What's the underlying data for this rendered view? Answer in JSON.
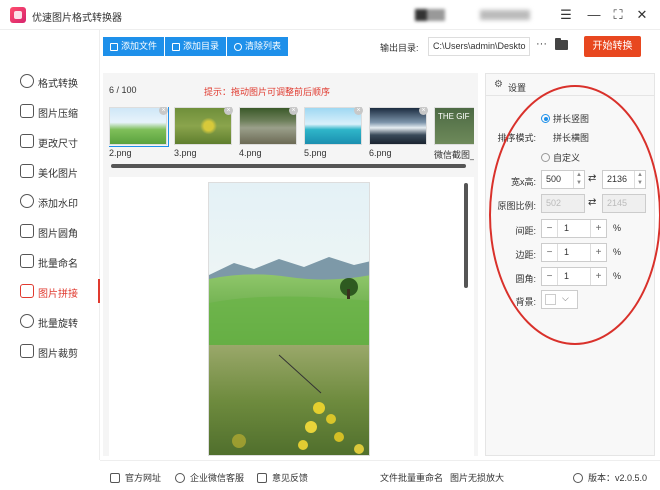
{
  "window": {
    "title": "优速图片格式转换器",
    "controls": [
      "menu",
      "minimize",
      "maximize",
      "close"
    ]
  },
  "sidebar": {
    "items": [
      {
        "label": "格式转换",
        "icon": "convert-icon",
        "active": false
      },
      {
        "label": "图片压缩",
        "icon": "compress-icon",
        "active": false
      },
      {
        "label": "更改尺寸",
        "icon": "resize-icon",
        "active": false
      },
      {
        "label": "美化图片",
        "icon": "beautify-icon",
        "active": false
      },
      {
        "label": "添加水印",
        "icon": "watermark-icon",
        "active": false
      },
      {
        "label": "图片圆角",
        "icon": "rounded-corner-icon",
        "active": false
      },
      {
        "label": "批量命名",
        "icon": "rename-icon",
        "active": false
      },
      {
        "label": "图片拼接",
        "icon": "stitch-icon",
        "active": true
      },
      {
        "label": "批量旋转",
        "icon": "rotate-icon",
        "active": false
      },
      {
        "label": "图片裁剪",
        "icon": "crop-icon",
        "active": false
      }
    ]
  },
  "toolbar": {
    "add_file": "添加文件",
    "add_folder": "添加目录",
    "clear_list": "清除列表",
    "output_label": "输出目录:",
    "output_path": "C:\\Users\\admin\\Deskto",
    "more": "···",
    "start": "开始转换"
  },
  "main": {
    "count": "6 / 100",
    "tip": "提示：拖动图片可调整前后顺序",
    "thumbnails": [
      {
        "name": "2.png"
      },
      {
        "name": "3.png"
      },
      {
        "name": "4.png"
      },
      {
        "name": "5.png"
      },
      {
        "name": "6.png"
      },
      {
        "name": "微信截图_",
        "text": "THE GIF"
      }
    ],
    "remove_glyph": "×"
  },
  "settings": {
    "title": "设置",
    "sort_label": "排序模式:",
    "sort_options": [
      "拼长竖图",
      "拼长横图",
      "自定义"
    ],
    "sort_selected": 0,
    "size_label": "宽x高:",
    "width": "500",
    "height": "2136",
    "ratio_label": "原图比例:",
    "ratio_w": "502",
    "ratio_h": "2145",
    "swap_glyph": "⇄",
    "spacing_label": "间距:",
    "spacing": "1",
    "margin_label": "边距:",
    "margin": "1",
    "corner_label": "圆角:",
    "corner": "1",
    "percent": "%",
    "bg_label": "背景:",
    "bg_color": "#ffffff"
  },
  "footer": {
    "website": "官方网址",
    "wechat": "企业微信客服",
    "feedback": "意见反馈",
    "batch_rename": "文件批量重命名",
    "lossless": "图片无损放大",
    "version": "版本：v2.0.5.0"
  },
  "colors": {
    "accent": "#1e90ea",
    "start_button": "#e8471f",
    "active_nav": "#e03a2f",
    "annotation_ellipse": "#d9312b"
  }
}
